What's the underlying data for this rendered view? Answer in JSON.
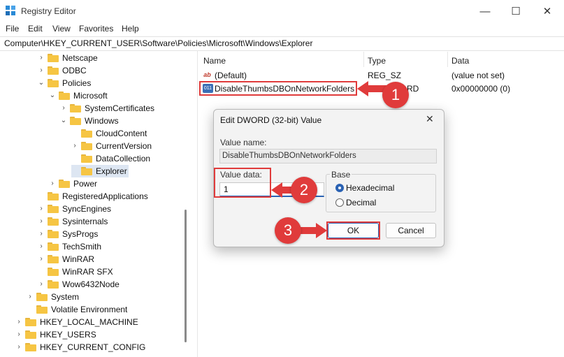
{
  "window": {
    "title": "Registry Editor",
    "minimize": "—",
    "maximize": "☐",
    "close": "✕"
  },
  "menu": [
    "File",
    "Edit",
    "View",
    "Favorites",
    "Help"
  ],
  "address": "Computer\\HKEY_CURRENT_USER\\Software\\Policies\\Microsoft\\Windows\\Explorer",
  "tree": [
    {
      "label": "Netscape",
      "chev": "›"
    },
    {
      "label": "ODBC",
      "chev": "›"
    },
    {
      "label": "Policies",
      "chev": "⌄"
    },
    {
      "label": "Microsoft",
      "chev": "⌄"
    },
    {
      "label": "SystemCertificates",
      "chev": "›"
    },
    {
      "label": "Windows",
      "chev": "⌄"
    },
    {
      "label": "CloudContent",
      "chev": ""
    },
    {
      "label": "CurrentVersion",
      "chev": "›"
    },
    {
      "label": "DataCollection",
      "chev": ""
    },
    {
      "label": "Explorer",
      "chev": ""
    },
    {
      "label": "Power",
      "chev": "›"
    },
    {
      "label": "RegisteredApplications",
      "chev": ""
    },
    {
      "label": "SyncEngines",
      "chev": "›"
    },
    {
      "label": "Sysinternals",
      "chev": "›"
    },
    {
      "label": "SysProgs",
      "chev": "›"
    },
    {
      "label": "TechSmith",
      "chev": "›"
    },
    {
      "label": "WinRAR",
      "chev": "›"
    },
    {
      "label": "WinRAR SFX",
      "chev": ""
    },
    {
      "label": "Wow6432Node",
      "chev": "›"
    },
    {
      "label": "System",
      "chev": "›"
    },
    {
      "label": "Volatile Environment",
      "chev": ""
    },
    {
      "label": "HKEY_LOCAL_MACHINE",
      "chev": "›"
    },
    {
      "label": "HKEY_USERS",
      "chev": "›"
    },
    {
      "label": "HKEY_CURRENT_CONFIG",
      "chev": "›"
    }
  ],
  "list": {
    "headers": {
      "name": "Name",
      "type": "Type",
      "data": "Data"
    },
    "rows": [
      {
        "name": "(Default)",
        "type": "REG_SZ",
        "data": "(value not set)",
        "icon": "ab"
      },
      {
        "name": "DisableThumbsDBOnNetworkFolders",
        "type": "REG_DWORD",
        "type_visible": "RD",
        "data": "0x00000000 (0)",
        "icon": "011"
      }
    ]
  },
  "dialog": {
    "title": "Edit DWORD (32-bit) Value",
    "close": "✕",
    "value_name_label": "Value name:",
    "value_name": "DisableThumbsDBOnNetworkFolders",
    "value_data_label": "Value data:",
    "value_data": "1",
    "base_label": "Base",
    "hex_label": "Hexadecimal",
    "dec_label": "Decimal",
    "base_selected": "Hexadecimal",
    "ok": "OK",
    "cancel": "Cancel"
  },
  "callouts": [
    "1",
    "2",
    "3"
  ],
  "colors": {
    "accent": "#2a62b3",
    "callout": "#e03b3b",
    "folder": "#f6c543"
  }
}
